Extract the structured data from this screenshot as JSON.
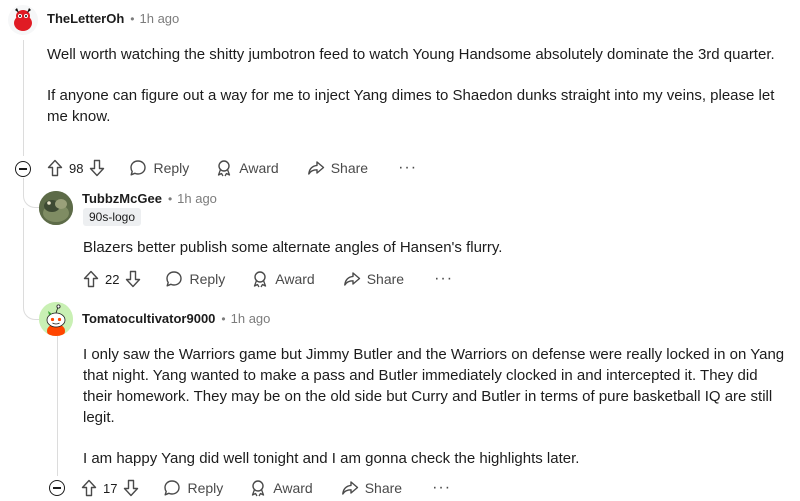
{
  "comments": [
    {
      "username": "TheLetterOh",
      "time": "1h ago",
      "paragraphs": [
        "Well worth watching the shitty jumbotron feed to watch Young Handsome absolutely dominate the 3rd quarter.",
        "If anyone can figure out a way for me to inject Yang dimes to Shaedon dunks straight into my veins, please let me know."
      ],
      "votes": "98",
      "reply_label": "Reply",
      "award_label": "Award",
      "share_label": "Share",
      "more_label": "···"
    },
    {
      "username": "TubbzMcGee",
      "time": "1h ago",
      "flair": "90s-logo",
      "paragraphs": [
        "Blazers better publish some alternate angles of Hansen's flurry."
      ],
      "votes": "22",
      "reply_label": "Reply",
      "award_label": "Award",
      "share_label": "Share",
      "more_label": "···"
    },
    {
      "username": "Tomatocultivator9000",
      "time": "1h ago",
      "paragraphs": [
        "I only saw the Warriors game but Jimmy Butler and the Warriors on defense were really locked in on Yang that night. Yang wanted to make a pass and Butler immediately clocked in and intercepted it. They did their homework. They may be on the old side but Curry and Butler in terms of pure basketball IQ are still legit.",
        "I am happy Yang did well tonight and I am gonna check the highlights later."
      ],
      "votes": "17",
      "reply_label": "Reply",
      "award_label": "Award",
      "share_label": "Share",
      "more_label": "···"
    }
  ],
  "separator": "•",
  "icons": {
    "upvote": "upvote-arrow-icon",
    "downvote": "downvote-arrow-icon",
    "reply": "speech-bubble-icon",
    "award": "award-ribbon-icon",
    "share": "share-arrow-icon",
    "collapse": "collapse-minus-icon"
  },
  "colors": {
    "text": "#1c1c1c",
    "meta": "#7c7c7c",
    "thread_line": "#dcdcdc",
    "flair_bg": "#edeff1"
  }
}
